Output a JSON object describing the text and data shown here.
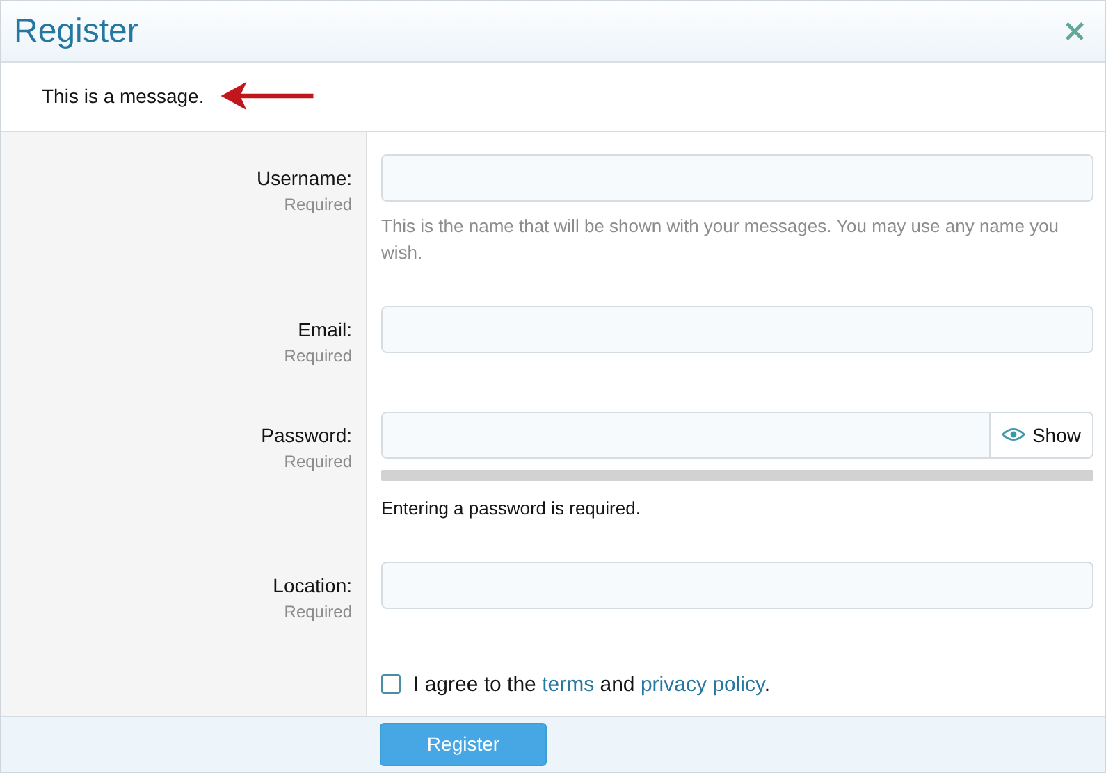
{
  "dialog": {
    "title": "Register",
    "message": "This is a message."
  },
  "fields": [
    {
      "kind": "text",
      "label": "Username:",
      "note": "Required",
      "hint": "This is the name that will be shown with your messages. You may use any name you wish."
    },
    {
      "kind": "text",
      "label": "Email:",
      "note": "Required"
    },
    {
      "kind": "password",
      "label": "Password:",
      "note": "Required",
      "toggle": "Show",
      "strength": {
        "level": 0
      },
      "hint": "Entering a password is required."
    },
    {
      "kind": "text",
      "label": "Location:",
      "note": "Required"
    }
  ],
  "agreement": {
    "checked": false,
    "parts": [
      {
        "kind": "text",
        "text": "I agree to the "
      },
      {
        "kind": "link",
        "text": "terms"
      },
      {
        "kind": "text",
        "text": " and "
      },
      {
        "kind": "link",
        "text": "privacy policy"
      },
      {
        "kind": "text",
        "text": "."
      }
    ]
  },
  "submit": "Register"
}
